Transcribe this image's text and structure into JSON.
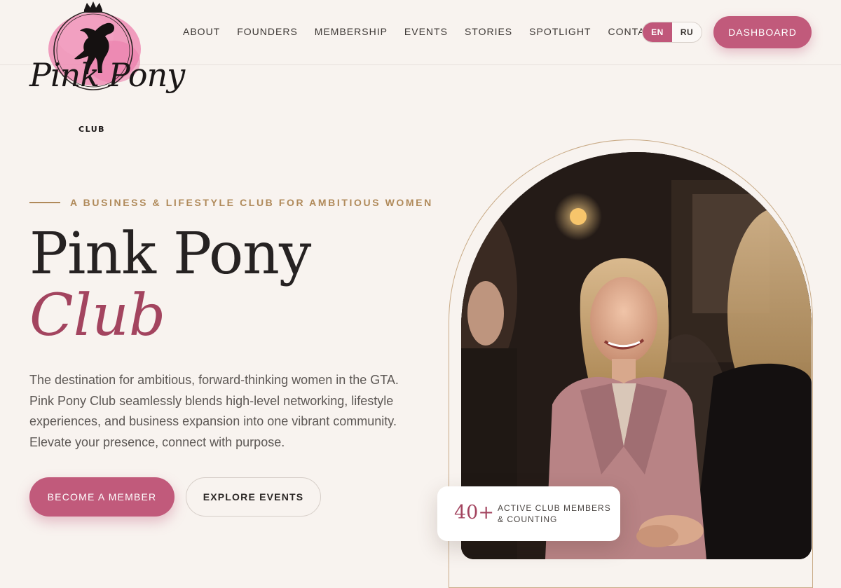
{
  "brand": {
    "name_script": "Pink Pony",
    "name_sub": "CLUB",
    "logo_icon": "rearing-horse-crown-icon",
    "accent_color": "#c15a7b",
    "gold_color": "#b08a5a"
  },
  "nav": {
    "items": [
      "ABOUT",
      "FOUNDERS",
      "MEMBERSHIP",
      "EVENTS",
      "STORIES",
      "SPOTLIGHT",
      "CONTACT"
    ],
    "lang_options": [
      "EN",
      "RU"
    ],
    "lang_selected": "EN",
    "dashboard_label": "DASHBOARD"
  },
  "hero": {
    "tagline": "A BUSINESS & LIFESTYLE CLUB FOR AMBITIOUS WOMEN",
    "title_line1": "Pink Pony",
    "title_line2": "Club",
    "description": "The destination for ambitious, forward-thinking women in the GTA. Pink Pony Club seamlessly blends high-level networking, lifestyle experiences, and business expansion into one vibrant community. Elevate your presence, connect with purpose.",
    "primary_cta": "BECOME A MEMBER",
    "secondary_cta": "EXPLORE EVENTS",
    "image_icon": "women-networking-photo"
  },
  "stat": {
    "number": "40+",
    "label": "ACTIVE CLUB MEMBERS & COUNTING"
  }
}
